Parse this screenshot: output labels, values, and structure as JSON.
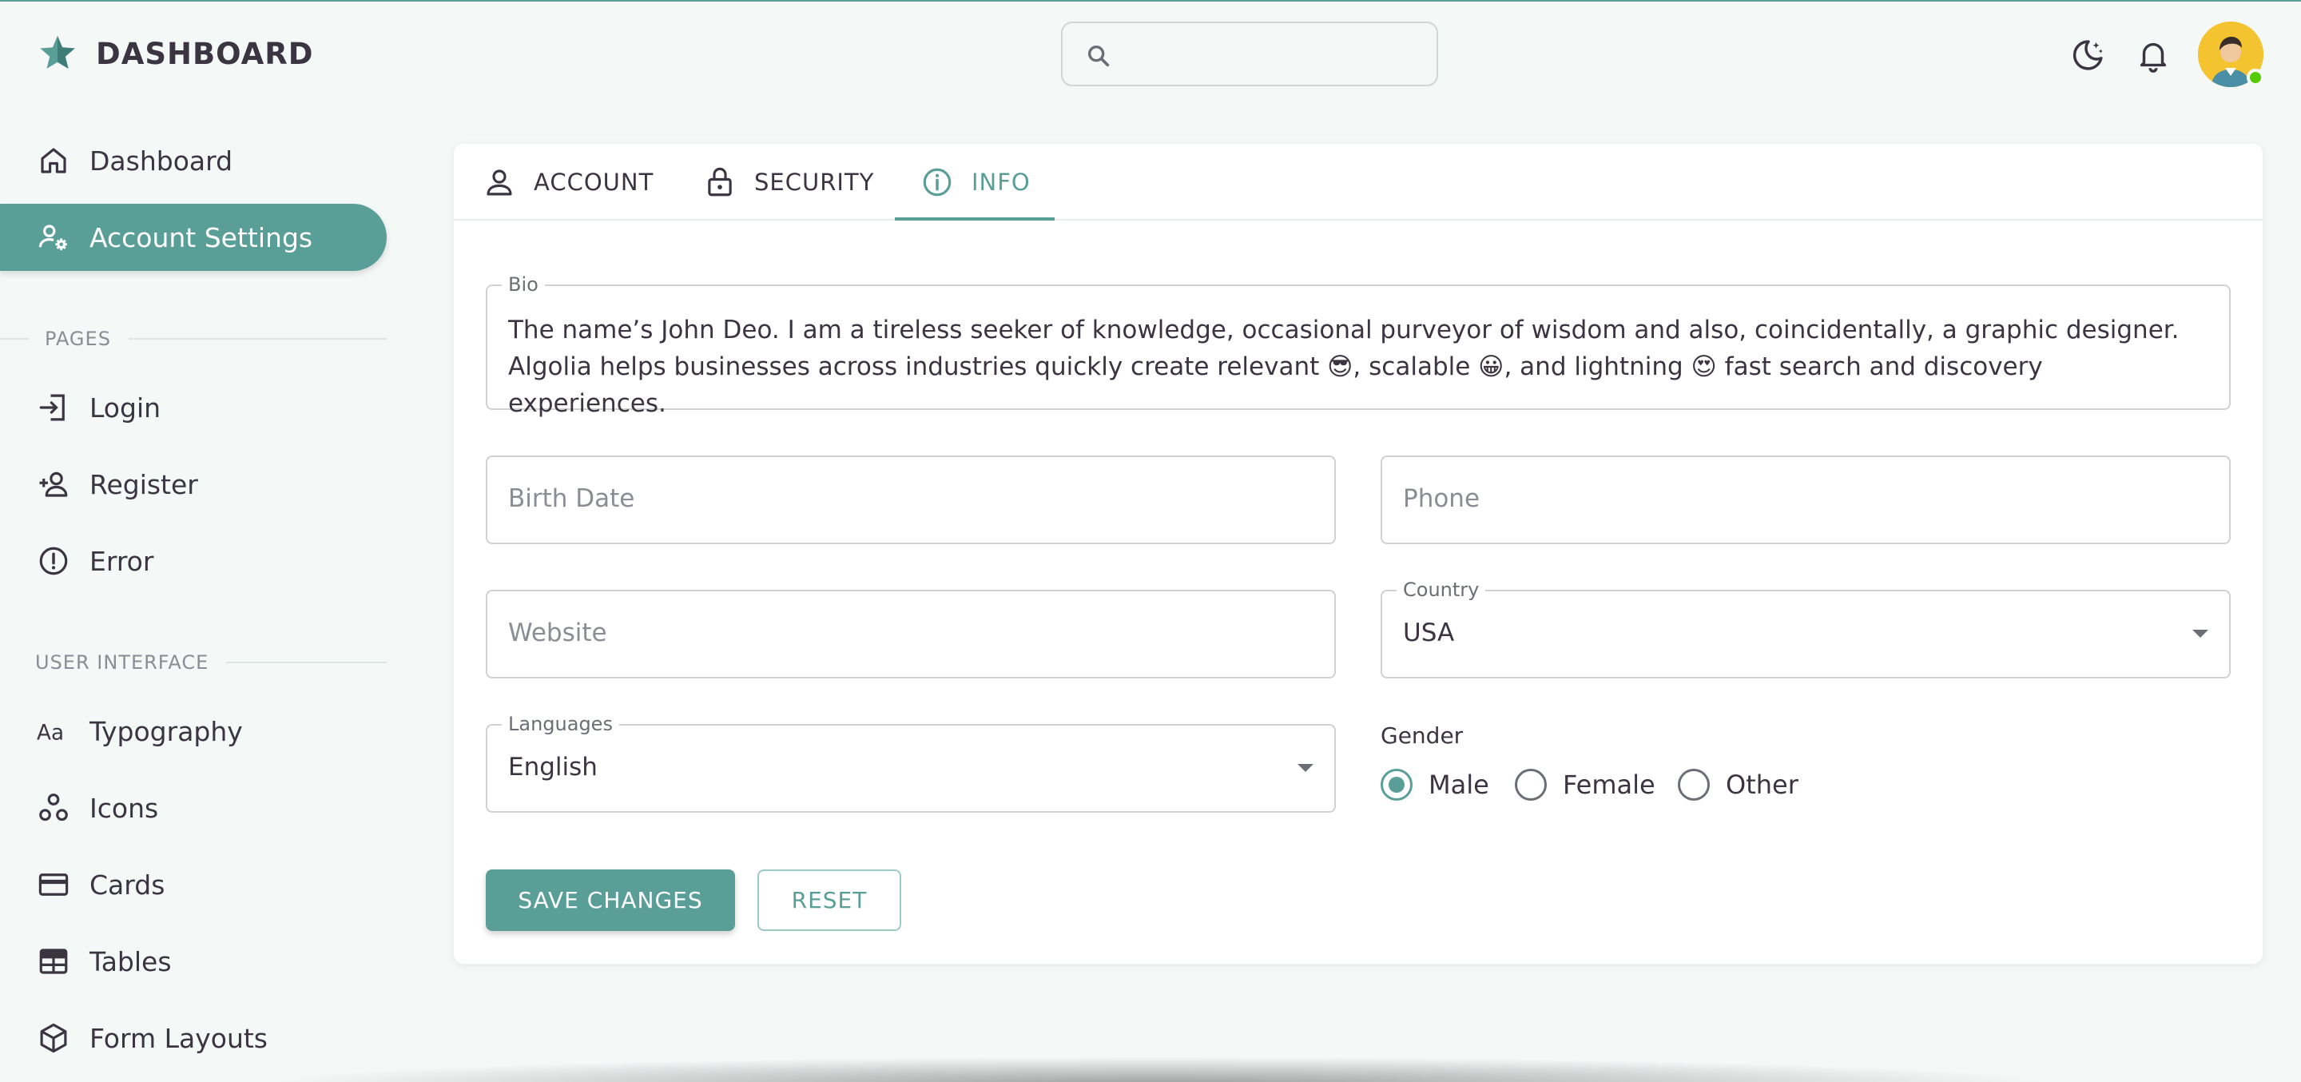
{
  "app": {
    "title": "DASHBOARD"
  },
  "search": {
    "placeholder": ""
  },
  "sidebar": {
    "items": [
      {
        "label": "Dashboard",
        "icon": "home-icon"
      },
      {
        "label": "Account Settings",
        "icon": "account-cog-icon",
        "active": true
      }
    ],
    "pages_header": "PAGES",
    "pages": [
      {
        "label": "Login",
        "icon": "login-icon"
      },
      {
        "label": "Register",
        "icon": "account-plus-icon"
      },
      {
        "label": "Error",
        "icon": "alert-circle-icon"
      }
    ],
    "ui_header": "USER INTERFACE",
    "ui": [
      {
        "label": "Typography",
        "icon": "format-letter-case-icon"
      },
      {
        "label": "Icons",
        "icon": "google-circles-icon"
      },
      {
        "label": "Cards",
        "icon": "credit-card-icon"
      },
      {
        "label": "Tables",
        "icon": "table-icon"
      },
      {
        "label": "Form Layouts",
        "icon": "cube-icon"
      }
    ]
  },
  "tabs": [
    {
      "label": "ACCOUNT",
      "icon": "account-icon"
    },
    {
      "label": "SECURITY",
      "icon": "lock-open-icon"
    },
    {
      "label": "INFO",
      "icon": "information-icon",
      "active": true
    }
  ],
  "form": {
    "bio": {
      "label": "Bio",
      "line1": "The name’s John Deo. I am a tireless seeker of knowledge, occasional purveyor of wisdom and also, coincidentally, a graphic designer.",
      "line2": "Algolia helps businesses across industries quickly create relevant 😎, scalable 😀, and lightning 😍 fast search and discovery experiences."
    },
    "birth_date": {
      "placeholder": "Birth Date"
    },
    "phone": {
      "placeholder": "Phone"
    },
    "website": {
      "placeholder": "Website"
    },
    "country": {
      "label": "Country",
      "value": "USA"
    },
    "languages": {
      "label": "Languages",
      "value": "English"
    },
    "gender": {
      "label": "Gender",
      "options": [
        "Male",
        "Female",
        "Other"
      ],
      "selected": "Male"
    },
    "save_label": "SAVE CHANGES",
    "reset_label": "RESET"
  },
  "colors": {
    "accent": "#5a9e98",
    "text": "#3a3541",
    "background": "#f4f8f7",
    "online": "#56ca00"
  }
}
